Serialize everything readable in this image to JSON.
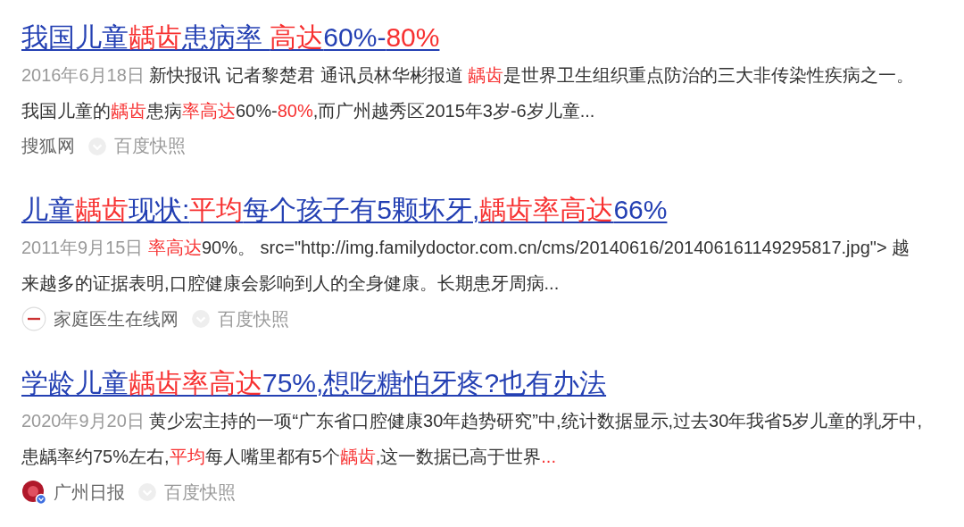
{
  "results": [
    {
      "title": [
        {
          "text": "我国儿童",
          "hl": false
        },
        {
          "text": "龋齿",
          "hl": true
        },
        {
          "text": "患病率 ",
          "hl": false
        },
        {
          "text": "高达",
          "hl": true
        },
        {
          "text": "60%-",
          "hl": false
        },
        {
          "text": "80%",
          "hl": true
        }
      ],
      "date": "2016年6月18日",
      "snippet": [
        {
          "text": "新快报讯 记者黎楚君 通讯员林华彬报道 ",
          "hl": false
        },
        {
          "text": "龋齿",
          "hl": true
        },
        {
          "text": "是世界卫生组织重点防治的三大非传染性疾病之一。我国儿童的",
          "hl": false
        },
        {
          "text": "龋齿",
          "hl": true
        },
        {
          "text": "患病",
          "hl": false
        },
        {
          "text": "率高达",
          "hl": true
        },
        {
          "text": "60%-",
          "hl": false
        },
        {
          "text": "80%",
          "hl": true
        },
        {
          "text": ",而广州越秀区2015年3岁-6岁儿童...",
          "hl": false
        }
      ],
      "source": {
        "name": "搜狐网",
        "logo": false
      },
      "snapshot": "百度快照"
    },
    {
      "title": [
        {
          "text": "儿童",
          "hl": false
        },
        {
          "text": "龋齿",
          "hl": true
        },
        {
          "text": "现状:",
          "hl": false
        },
        {
          "text": "平均",
          "hl": true
        },
        {
          "text": "每个孩子有5颗坏牙,",
          "hl": false
        },
        {
          "text": "龋齿率高达",
          "hl": true
        },
        {
          "text": "66%",
          "hl": false
        }
      ],
      "date": "2011年9月15日",
      "snippet": [
        {
          "text": "率高达",
          "hl": true
        },
        {
          "text": "90%。 src=\"http://img.familydoctor.com.cn/cms/20140616/201406161149295817.jpg\"> 越来越多的证据表明,口腔健康会影响到人的全身健康。长期患牙周病...",
          "hl": false
        }
      ],
      "source": {
        "name": "家庭医生在线网",
        "logo": true,
        "verified": false
      },
      "snapshot": "百度快照"
    },
    {
      "title": [
        {
          "text": "学龄儿童",
          "hl": false
        },
        {
          "text": "龋齿率高达",
          "hl": true
        },
        {
          "text": "75%,想吃糖怕牙疼?也有办法",
          "hl": false
        }
      ],
      "date": "2020年9月20日",
      "snippet": [
        {
          "text": "黄少宏主持的一项“广东省口腔健康30年趋势研究”中,统计数据显示,过去30年我省5岁儿童的乳牙中,患龋率约75%左右,",
          "hl": false
        },
        {
          "text": "平均",
          "hl": true
        },
        {
          "text": "每人嘴里都有5个",
          "hl": false
        },
        {
          "text": "龋齿",
          "hl": true
        },
        {
          "text": ",这一数据已高于世界",
          "hl": false
        },
        {
          "text": "...",
          "hl": true
        }
      ],
      "source": {
        "name": "广州日报",
        "logo": true,
        "verified": true
      },
      "snapshot": "百度快照"
    }
  ]
}
